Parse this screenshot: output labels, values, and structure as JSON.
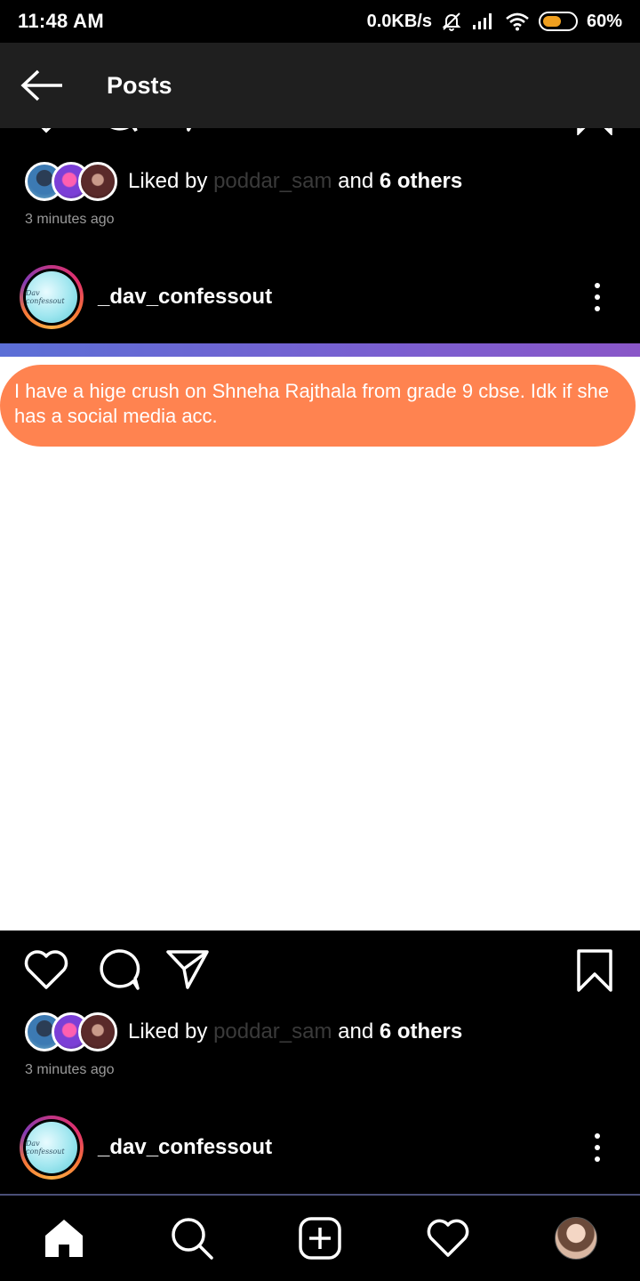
{
  "status_bar": {
    "time": "11:48 AM",
    "net_speed": "0.0KB/s",
    "battery": "60%",
    "battery_level": 0.6,
    "battery_color": "#f0a020"
  },
  "header": {
    "title": "Posts",
    "back_icon": "arrow-left-icon"
  },
  "posts": [
    {
      "liked_by_prefix": "Liked by",
      "liked_by_user": "poddar_sam",
      "liked_by_and": "and",
      "liked_by_others": "6 others",
      "time_ago": "3 minutes ago"
    },
    {
      "username": "_dav_confessout",
      "avatar_text": "Dav confessout",
      "confession_text": "I have a hige crush on Shneha Rajthala from grade 9 cbse. Idk if she has a social media acc.",
      "liked_by_prefix": "Liked by",
      "liked_by_user": "poddar_sam",
      "liked_by_and": "and",
      "liked_by_others": "6 others",
      "time_ago": "3 minutes ago"
    },
    {
      "username": "_dav_confessout",
      "avatar_text": "Dav confessout"
    }
  ],
  "colors": {
    "bubble": "#ff8350",
    "gradient_bar": "#6c66d3",
    "header_bg": "#1f1f1f"
  },
  "bottom_nav": {
    "items": [
      "home-icon",
      "search-icon",
      "add-post-icon",
      "activity-heart-icon",
      "profile-avatar"
    ]
  }
}
